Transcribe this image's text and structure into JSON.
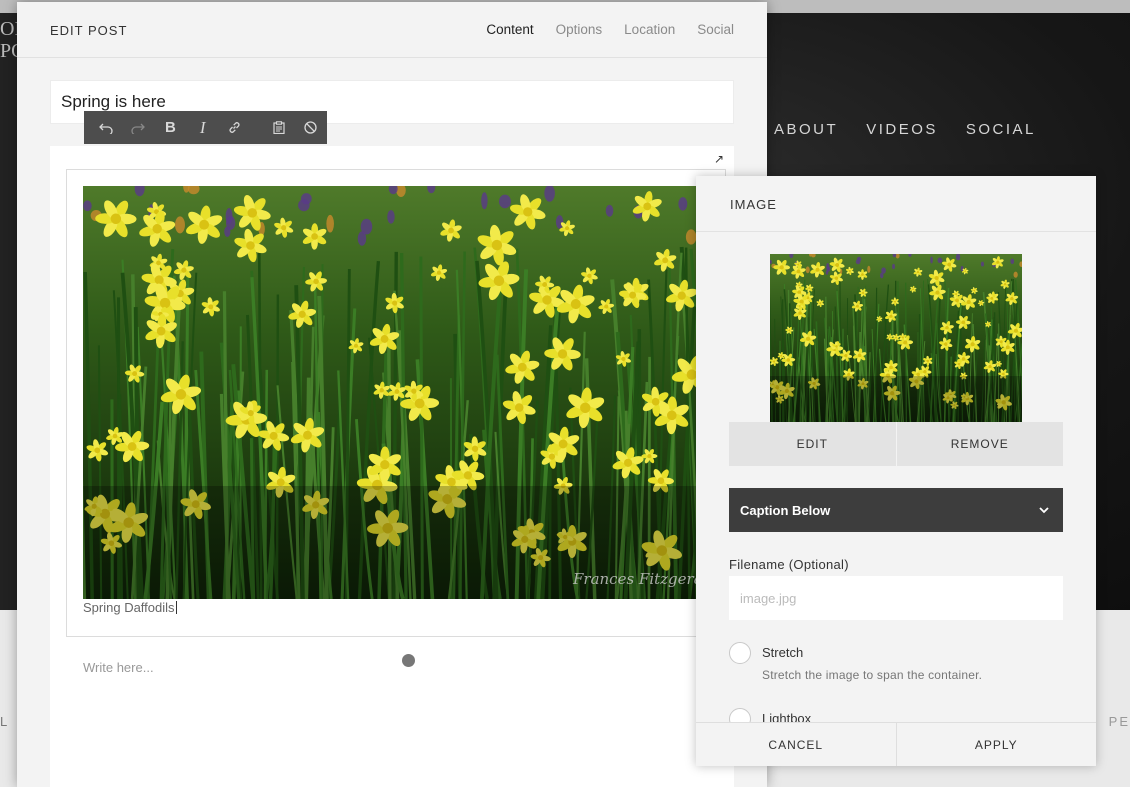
{
  "background": {
    "nav": [
      "ABOUT",
      "VIDEOS",
      "SOCIAL"
    ],
    "logo_fragment": [
      "OI",
      "PO"
    ],
    "lower_left_fragment": "L",
    "lower_right_fragment": "PE"
  },
  "modal": {
    "title": "EDIT POST",
    "tabs": [
      {
        "label": "Content",
        "active": true
      },
      {
        "label": "Options",
        "active": false
      },
      {
        "label": "Location",
        "active": false
      },
      {
        "label": "Social",
        "active": false
      }
    ],
    "post_title": "Spring is here",
    "toolbar": {
      "icons": [
        "undo-icon",
        "redo-icon",
        "bold-icon",
        "italic-icon",
        "link-icon",
        "paste-icon",
        "clear-format-icon"
      ],
      "bold_glyph": "B",
      "italic_glyph": "I"
    },
    "image_block": {
      "caption": "Spring Daffodils",
      "signature": "Frances Fitzgerald"
    },
    "body_placeholder": "Write here..."
  },
  "image_panel": {
    "title": "IMAGE",
    "edit_label": "EDIT",
    "remove_label": "REMOVE",
    "caption_option": "Caption Below",
    "filename_label": "Filename (Optional)",
    "filename_placeholder": "image.jpg",
    "filename_value": "",
    "options": [
      {
        "label": "Stretch",
        "description": "Stretch the image to span the container.",
        "checked": false
      },
      {
        "label": "Lightbox",
        "checked": false
      }
    ],
    "cancel_label": "CANCEL",
    "apply_label": "APPLY"
  },
  "colors": {
    "toolbar_bg": "#4d4d4d",
    "select_bg": "#3d3d3d",
    "panel_bg": "#f3f3f3",
    "flower_yellow": "#e8e02a"
  }
}
